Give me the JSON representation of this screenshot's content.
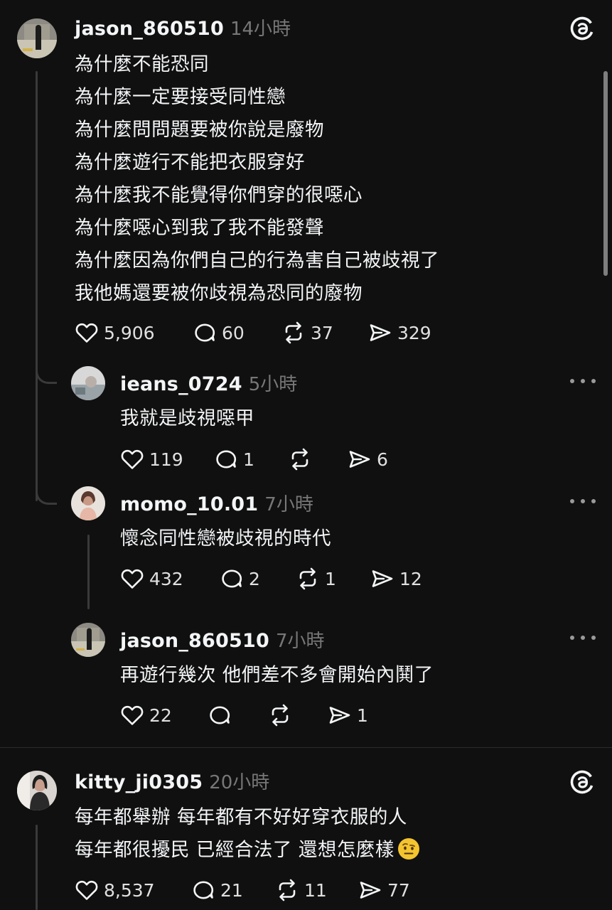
{
  "posts": [
    {
      "username": "jason_860510",
      "time": "14小時",
      "lines": [
        "為什麼不能恐同",
        "為什麼一定要接受同性戀",
        "為什麼問問題要被你說是廢物",
        "為什麼遊行不能把衣服穿好",
        "為什麼我不能覺得你們穿的很噁心",
        "為什麼噁心到我了我不能發聲",
        "為什麼因為你們自己的行為害自己被歧視了",
        "我他媽還要被你歧視為恐同的廢物"
      ],
      "likes": "5,906",
      "comments": "60",
      "reposts": "37",
      "shares": "329"
    },
    {
      "username": "kitty_ji0305",
      "time": "20小時",
      "lines": [
        "每年都舉辦 每年都有不好好穿衣服的人",
        "每年都很擾民 已經合法了 還想怎麼樣"
      ],
      "likes": "8,537",
      "comments": "21",
      "reposts": "11",
      "shares": "77"
    }
  ],
  "replies": [
    {
      "username": "ieans_0724",
      "time": "5小時",
      "text": "我就是歧視噁甲",
      "likes": "119",
      "comments": "1",
      "reposts": "",
      "shares": "6"
    },
    {
      "username": "momo_10.01",
      "time": "7小時",
      "text": "懷念同性戀被歧視的時代",
      "likes": "432",
      "comments": "2",
      "reposts": "1",
      "shares": "12"
    },
    {
      "username": "jason_860510",
      "time": "7小時",
      "text": "再遊行幾次 他們差不多會開始內鬨了",
      "likes": "22",
      "comments": "",
      "reposts": "",
      "shares": "1"
    }
  ],
  "icons": {
    "like": "heart-icon",
    "comment": "comment-bubble-icon",
    "repost": "repost-icon",
    "share": "send-icon",
    "more": "more-horizontal-icon",
    "app": "threads-logo-icon",
    "emoji": "raised-eyebrow-emoji"
  },
  "colors": {
    "background": "#101010",
    "text": "#f3f5f7",
    "muted": "#777777",
    "thread_line": "#3a3a3a"
  }
}
